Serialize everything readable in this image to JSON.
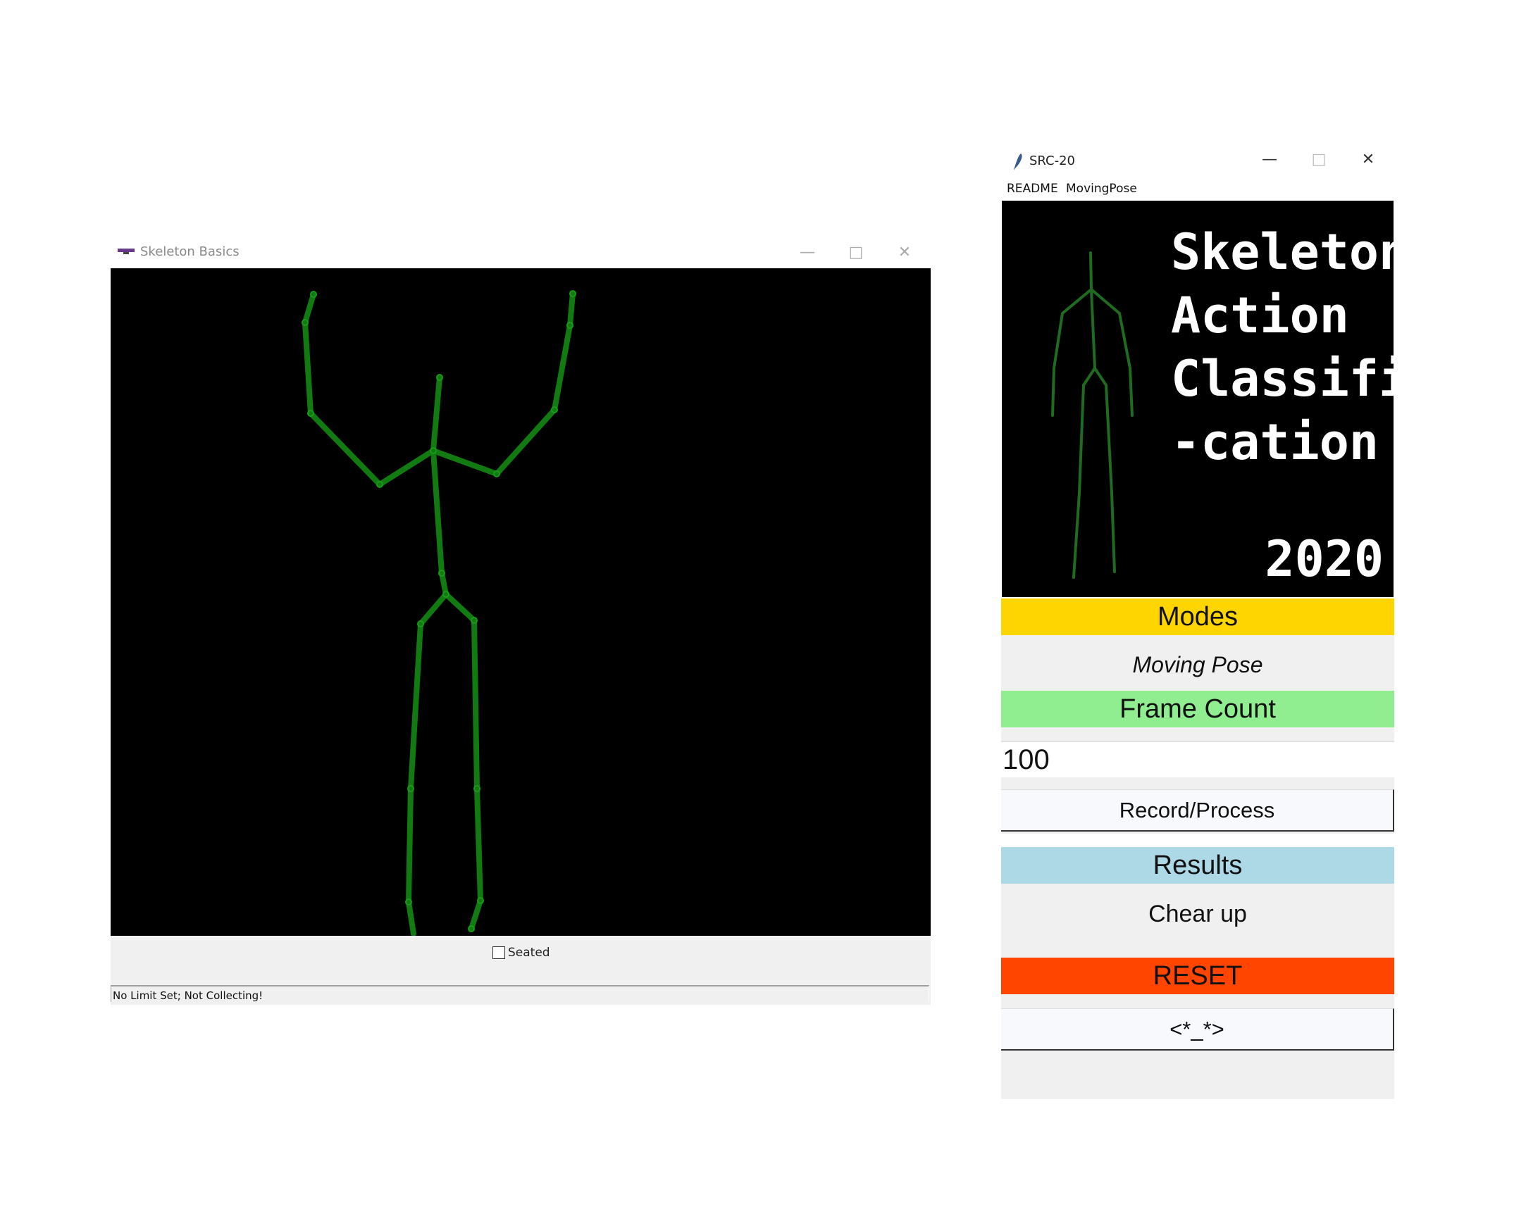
{
  "skeleton_window": {
    "title": "Skeleton Basics",
    "controls": {
      "minimize": "—",
      "maximize": "□",
      "close": "✕"
    },
    "seated_label": "Seated",
    "seated_checked": false,
    "status": "No Limit Set; Not Collecting!",
    "bone_color": "#117a11",
    "canvas_color": "#000000"
  },
  "src_window": {
    "title": "SRC-20",
    "controls": {
      "minimize": "—",
      "maximize": "□",
      "close": "✕"
    },
    "menu": [
      "README",
      "MovingPose"
    ],
    "banner": {
      "title": "Skeleton\nAction\nClassifi\n-cation",
      "year": "2020"
    },
    "modes_header": "Modes",
    "mode_value": "Moving Pose",
    "frame_count_header": "Frame Count",
    "frame_count_value": "100",
    "record_button": "Record/Process",
    "results_header": "Results",
    "result_value": "Chear up",
    "reset_button": "RESET",
    "face_button": "<*_*>",
    "colors": {
      "modes": "#ffd500",
      "frame_count": "#90ee90",
      "results": "#add8e6",
      "reset": "#ff4500"
    }
  }
}
